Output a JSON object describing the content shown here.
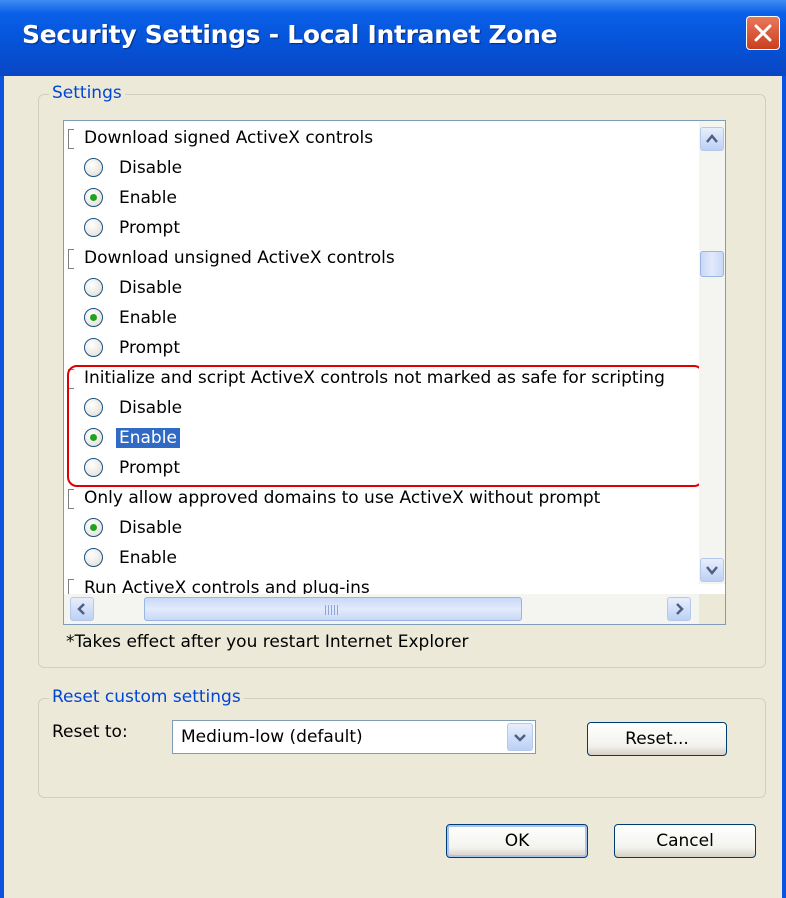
{
  "window": {
    "title": "Security Settings - Local Intranet Zone"
  },
  "settings_group": {
    "legend": "Settings",
    "items": [
      {
        "type": "heading",
        "text": "Download signed ActiveX controls"
      },
      {
        "type": "option",
        "text": "Disable",
        "checked": false,
        "selected": false
      },
      {
        "type": "option",
        "text": "Enable",
        "checked": true,
        "selected": false
      },
      {
        "type": "option",
        "text": "Prompt",
        "checked": false,
        "selected": false
      },
      {
        "type": "heading",
        "text": "Download unsigned ActiveX controls"
      },
      {
        "type": "option",
        "text": "Disable",
        "checked": false,
        "selected": false
      },
      {
        "type": "option",
        "text": "Enable",
        "checked": true,
        "selected": false
      },
      {
        "type": "option",
        "text": "Prompt",
        "checked": false,
        "selected": false
      },
      {
        "type": "heading",
        "text": "Initialize and script ActiveX controls not marked as safe for scripting"
      },
      {
        "type": "option",
        "text": "Disable",
        "checked": false,
        "selected": false
      },
      {
        "type": "option",
        "text": "Enable",
        "checked": true,
        "selected": true
      },
      {
        "type": "option",
        "text": "Prompt",
        "checked": false,
        "selected": false
      },
      {
        "type": "heading",
        "text": "Only allow approved domains to use ActiveX without prompt"
      },
      {
        "type": "option",
        "text": "Disable",
        "checked": true,
        "selected": false
      },
      {
        "type": "option",
        "text": "Enable",
        "checked": false,
        "selected": false
      },
      {
        "type": "heading",
        "text": "Run ActiveX controls and plug-ins"
      }
    ],
    "note": "*Takes effect after you restart Internet Explorer"
  },
  "reset_group": {
    "legend": "Reset custom settings",
    "reset_to_label": "Reset to:",
    "selected_level": "Medium-low (default)",
    "reset_button": "Reset..."
  },
  "buttons": {
    "ok": "OK",
    "cancel": "Cancel"
  },
  "colors": {
    "titlebar": "#0552d6",
    "dialog_bg": "#ece9d8",
    "legend_text": "#0046d5",
    "selection": "#316ac5",
    "highlight_outline": "#e00000"
  }
}
